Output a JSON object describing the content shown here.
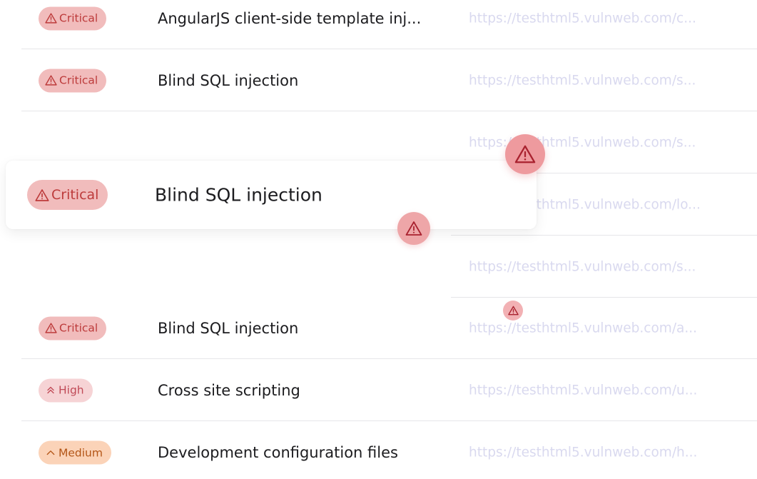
{
  "rows": [
    {
      "severity": "Critical",
      "title": "AngularJS client-side template inj...",
      "url": "https://testhtml5.vulnweb.com/c..."
    },
    {
      "severity": "Critical",
      "title": "Blind SQL injection",
      "url": "https://testhtml5.vulnweb.com/s..."
    },
    {
      "url": "https://testhtml5.vulnweb.com/s..."
    },
    {
      "url": "https://testhtml5.vulnweb.com/lo..."
    },
    {
      "url": "https://testhtml5.vulnweb.com/s..."
    },
    {
      "severity": "Critical",
      "title": "Blind SQL injection",
      "url": "https://testhtml5.vulnweb.com/a..."
    },
    {
      "severity": "High",
      "title": "Cross site scripting",
      "url": "https://testhtml5.vulnweb.com/u..."
    },
    {
      "severity": "Medium",
      "title": "Development configuration files",
      "url": "https://testhtml5.vulnweb.com/h..."
    }
  ],
  "dragged_row": {
    "severity": "Critical",
    "title": "Blind SQL injection"
  },
  "icons": {
    "critical": "warning-triangle-icon",
    "high": "double-chevron-up-icon",
    "medium": "chevron-up-icon"
  },
  "colors": {
    "critical_bg": "#f1bcbc",
    "critical_text": "#bd3b3b",
    "high_bg": "#f6d3d5",
    "high_text": "#c04a57",
    "medium_bg": "#fbd3b8",
    "medium_text": "#b35516",
    "url_text": "#d9d9ef"
  }
}
